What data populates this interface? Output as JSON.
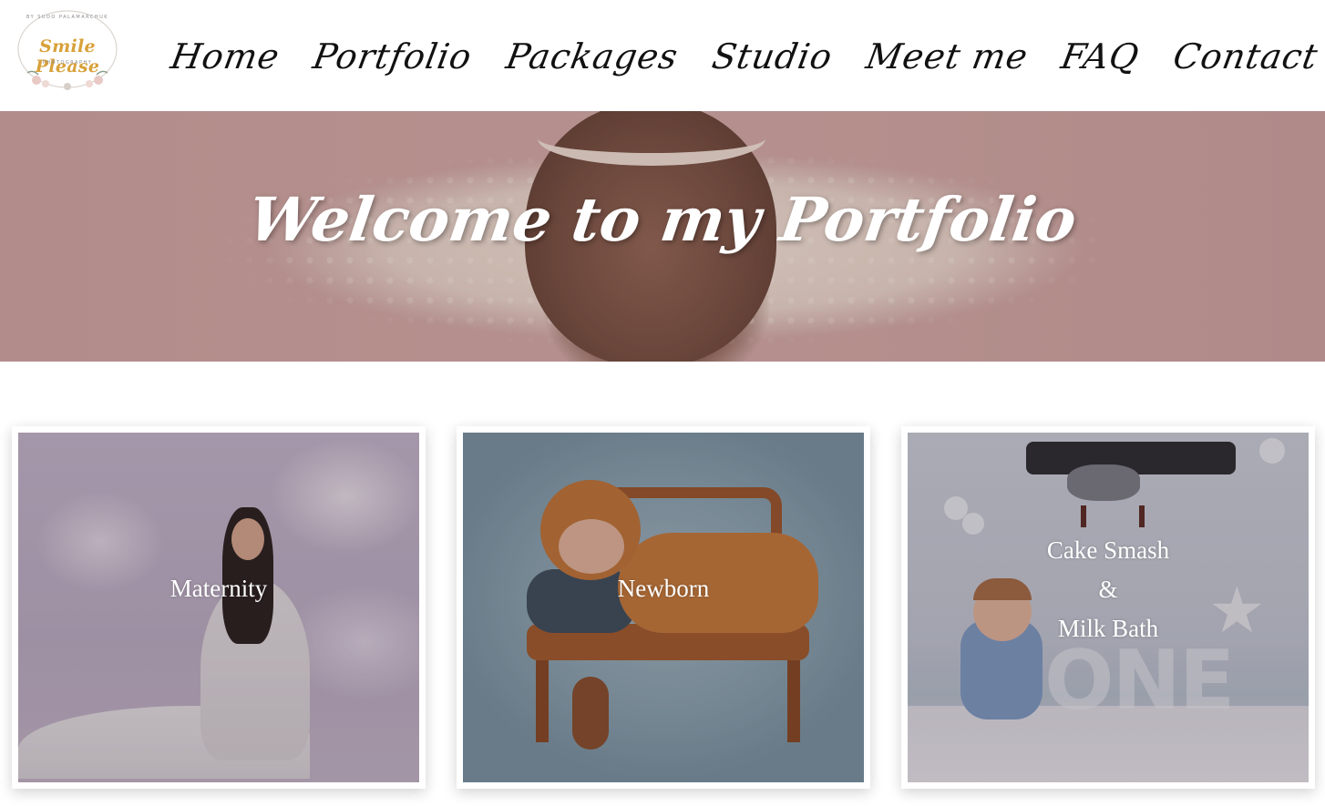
{
  "header": {
    "logo": {
      "name": "Smile Please",
      "tagline": "BY SUDO PALAMARCHUK",
      "sub": "PHOTOGRAPHY"
    },
    "nav": [
      {
        "label": "Home"
      },
      {
        "label": "Portfolio"
      },
      {
        "label": "Packages"
      },
      {
        "label": "Studio"
      },
      {
        "label": "Meet me"
      },
      {
        "label": "FAQ"
      },
      {
        "label": "Contact"
      }
    ]
  },
  "hero": {
    "title": "Welcome to my Portfolio"
  },
  "cards": {
    "maternity": {
      "label": "Maternity"
    },
    "newborn": {
      "label": "Newborn"
    },
    "cakesmash": {
      "line1": "Cake Smash",
      "line2": "&",
      "line3": "Milk Bath"
    }
  },
  "colors": {
    "logo_gold": "#d8a13a",
    "nav_text": "#111111",
    "hero_text": "#ffffff",
    "card_text": "#ffffff"
  }
}
